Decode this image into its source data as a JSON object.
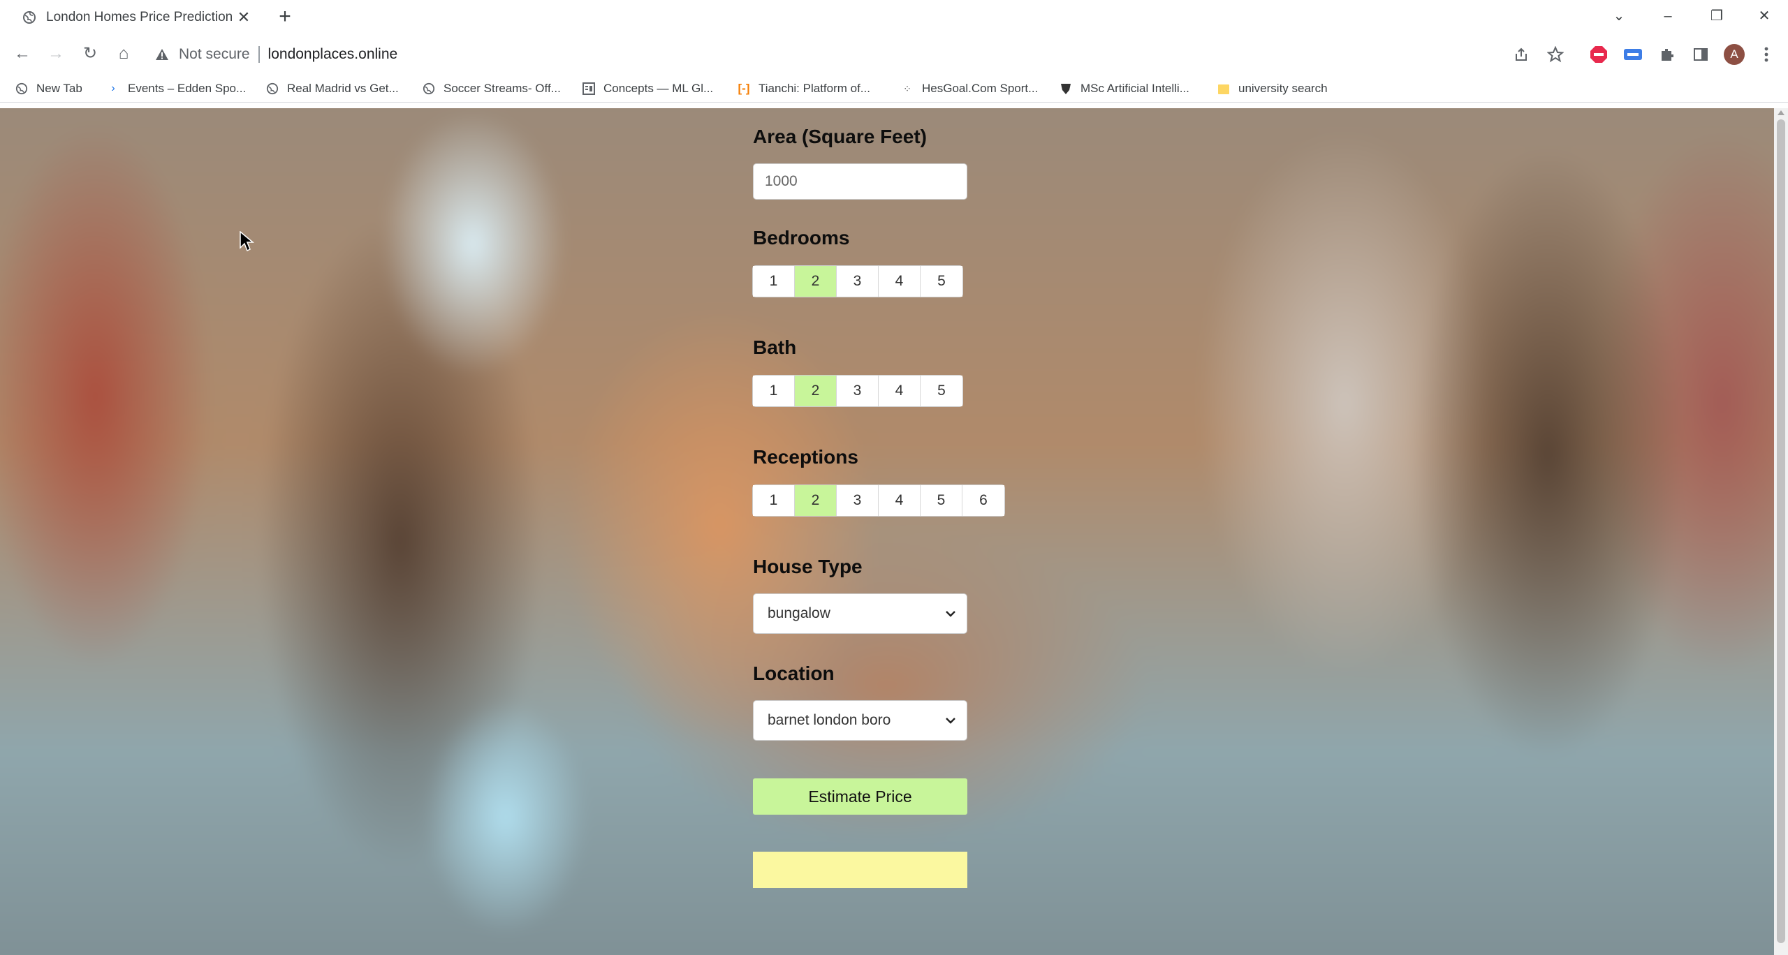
{
  "browser": {
    "tab_title": "London Homes Price Prediction",
    "security_label": "Not secure",
    "url": "londonplaces.online",
    "profile_initial": "A",
    "bookmarks": [
      {
        "label": "New Tab",
        "icon": "globe-icon"
      },
      {
        "label": "Events – Edden Spo...",
        "icon": "arrow-icon"
      },
      {
        "label": "Real Madrid vs Get...",
        "icon": "globe-icon"
      },
      {
        "label": "Soccer Streams- Off...",
        "icon": "globe-icon"
      },
      {
        "label": "Concepts — ML Gl...",
        "icon": "document-icon"
      },
      {
        "label": "Tianchi: Platform of...",
        "icon": "bracket-icon"
      },
      {
        "label": "HesGoal.Com Sport...",
        "icon": "dots-icon"
      },
      {
        "label": "MSc Artificial Intelli...",
        "icon": "crest-icon"
      },
      {
        "label": "university search",
        "icon": "folder-icon"
      }
    ]
  },
  "form": {
    "area_label": "Area (Square Feet)",
    "area_value": "1000",
    "bedrooms_label": "Bedrooms",
    "bedrooms_options": [
      "1",
      "2",
      "3",
      "4",
      "5"
    ],
    "bedrooms_selected": "2",
    "bath_label": "Bath",
    "bath_options": [
      "1",
      "2",
      "3",
      "4",
      "5"
    ],
    "bath_selected": "2",
    "receptions_label": "Receptions",
    "receptions_options": [
      "1",
      "2",
      "3",
      "4",
      "5",
      "6"
    ],
    "receptions_selected": "2",
    "house_type_label": "House Type",
    "house_type_value": "bungalow",
    "location_label": "Location",
    "location_value": "barnet london boro",
    "estimate_button": "Estimate Price",
    "result_text": ""
  },
  "colors": {
    "active_option": "#c8f59a",
    "estimate_button": "#c8f59a",
    "result_box": "#fbf8a0"
  }
}
